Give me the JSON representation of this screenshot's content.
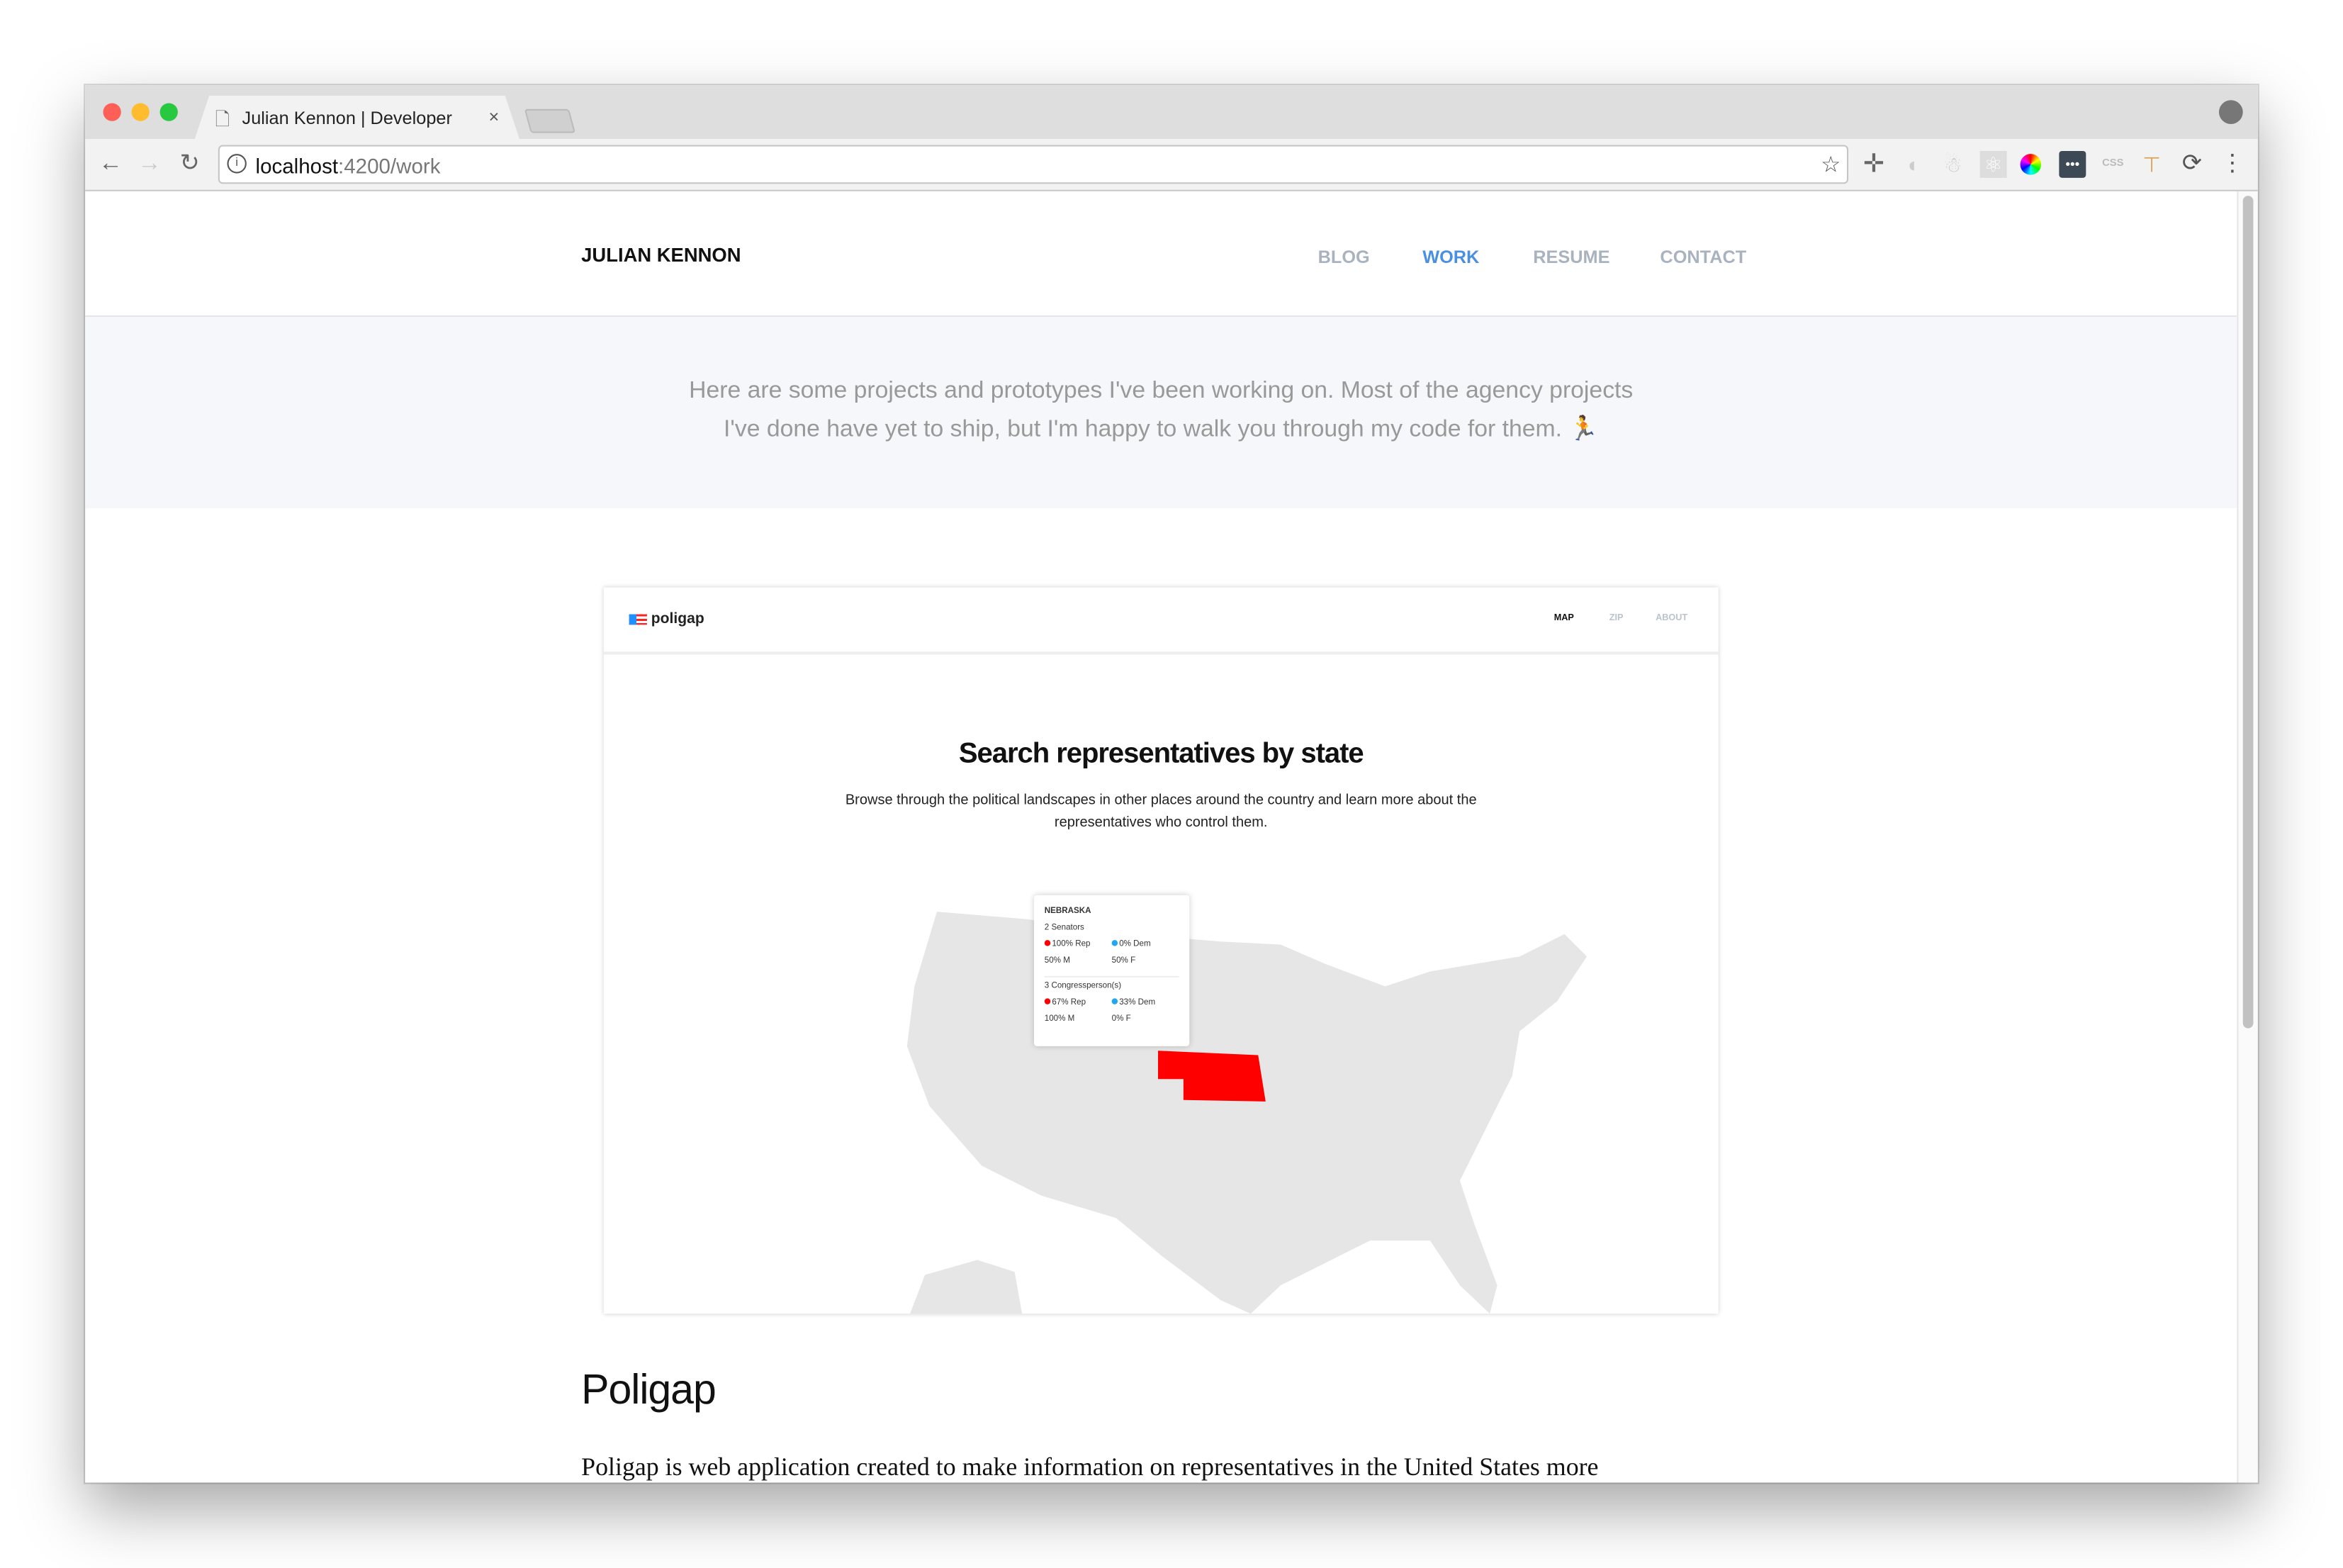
{
  "browser": {
    "tab_title": "Julian Kennon | Developer",
    "tab_close": "×",
    "url_host": "localhost",
    "url_path": ":4200/work",
    "toolbar_icons": [
      "bookmark-star-icon",
      "move-cross-icon",
      "json-viewer-icon",
      "ember-inspector-icon",
      "react-devtools-icon",
      "color-picker-icon",
      "lastpass-icon",
      "css-viewer-icon",
      "ruler-icon",
      "reload-extension-icon",
      "more-menu-icon"
    ]
  },
  "site": {
    "brand": "JULIAN KENNON",
    "nav": [
      {
        "label": "BLOG"
      },
      {
        "label": "WORK",
        "active": true
      },
      {
        "label": "RESUME"
      },
      {
        "label": "CONTACT"
      }
    ],
    "intro_line1": "Here are some projects and prototypes I've been working on. Most of the agency projects",
    "intro_line2": "I've done have yet to ship, but I'm happy to walk you through my code for them.",
    "intro_emoji": "🏃"
  },
  "project": {
    "title": "Poligap",
    "description": "Poligap is web application created to make information on representatives in the United States more"
  },
  "preview": {
    "logo": "poligap",
    "nav": [
      "MAP",
      "ZIP",
      "ABOUT"
    ],
    "title": "Search representatives by state",
    "subtitle": "Browse through the political landscapes in other places around the country and learn more about the representatives who control them.",
    "tooltip": {
      "state": "NEBRASKA",
      "senators": "2 Senators",
      "sen_rep": "100% Rep",
      "sen_dem": "0% Dem",
      "sen_m": "50% M",
      "sen_f": "50% F",
      "congress": "3 Congressperson(s)",
      "con_rep": "67% Rep",
      "con_dem": "33% Dem",
      "con_m": "100% M",
      "con_f": "0% F"
    }
  },
  "colors": {
    "accent": "#4a90e2",
    "rep": "#ff0000",
    "dem": "#1ea7f5",
    "map": "#e6e6e6"
  }
}
